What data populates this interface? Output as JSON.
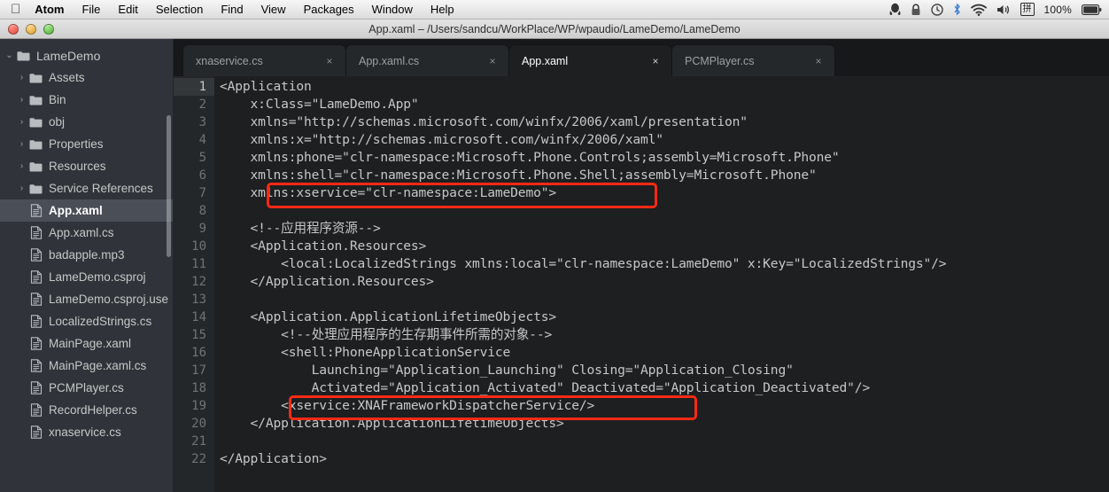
{
  "menubar": {
    "apple_icon": "apple-logo-icon",
    "items": [
      "Atom",
      "File",
      "Edit",
      "Selection",
      "Find",
      "View",
      "Packages",
      "Window",
      "Help"
    ],
    "status_icons": [
      "qq-penguin-icon",
      "lock-icon",
      "time-machine-icon",
      "bluetooth-icon",
      "wifi-icon",
      "volume-icon"
    ],
    "input_method_label": "拼",
    "battery_percent": "100%",
    "battery_icon": "battery-icon"
  },
  "window": {
    "title": "App.xaml – /Users/sandcu/WorkPlace/WP/wpaudio/LameDemo/LameDemo",
    "close_label": "close-window-button",
    "minimize_label": "minimize-window-button",
    "zoom_label": "zoom-window-button"
  },
  "sidebar": {
    "root": {
      "label": "LameDemo",
      "icon": "folder-icon",
      "disclosure": "⌄",
      "expanded": true
    },
    "items": [
      {
        "label": "Assets",
        "type": "folder",
        "icon": "folder-icon",
        "disclosure": "›",
        "selected": false
      },
      {
        "label": "Bin",
        "type": "folder",
        "icon": "folder-icon",
        "disclosure": "›",
        "selected": false
      },
      {
        "label": "obj",
        "type": "folder",
        "icon": "folder-icon",
        "disclosure": "›",
        "selected": false
      },
      {
        "label": "Properties",
        "type": "folder",
        "icon": "folder-icon",
        "disclosure": "›",
        "selected": false
      },
      {
        "label": "Resources",
        "type": "folder",
        "icon": "folder-icon",
        "disclosure": "›",
        "selected": false
      },
      {
        "label": "Service References",
        "type": "folder",
        "icon": "folder-icon",
        "disclosure": "›",
        "selected": false
      },
      {
        "label": "App.xaml",
        "type": "file",
        "icon": "file-icon",
        "selected": true
      },
      {
        "label": "App.xaml.cs",
        "type": "file",
        "icon": "file-icon",
        "selected": false
      },
      {
        "label": "badapple.mp3",
        "type": "file",
        "icon": "file-icon",
        "selected": false
      },
      {
        "label": "LameDemo.csproj",
        "type": "file",
        "icon": "file-icon",
        "selected": false
      },
      {
        "label": "LameDemo.csproj.use",
        "type": "file",
        "icon": "file-icon",
        "selected": false
      },
      {
        "label": "LocalizedStrings.cs",
        "type": "file",
        "icon": "file-icon",
        "selected": false
      },
      {
        "label": "MainPage.xaml",
        "type": "file",
        "icon": "file-icon",
        "selected": false
      },
      {
        "label": "MainPage.xaml.cs",
        "type": "file",
        "icon": "file-icon",
        "selected": false
      },
      {
        "label": "PCMPlayer.cs",
        "type": "file",
        "icon": "file-icon",
        "selected": false
      },
      {
        "label": "RecordHelper.cs",
        "type": "file",
        "icon": "file-icon",
        "selected": false
      },
      {
        "label": "xnaservice.cs",
        "type": "file",
        "icon": "file-icon",
        "selected": false
      }
    ]
  },
  "tabs": [
    {
      "label": "xnaservice.cs",
      "close": "×",
      "active": false
    },
    {
      "label": "App.xaml.cs",
      "close": "×",
      "active": false
    },
    {
      "label": "App.xaml",
      "close": "×",
      "active": true
    },
    {
      "label": "PCMPlayer.cs",
      "close": "×",
      "active": false
    }
  ],
  "editor": {
    "current_line": 1,
    "line_numbers": [
      "1",
      "2",
      "3",
      "4",
      "5",
      "6",
      "7",
      "8",
      "9",
      "10",
      "11",
      "12",
      "13",
      "14",
      "15",
      "16",
      "17",
      "18",
      "19",
      "20",
      "21",
      "22"
    ],
    "lines": [
      "<Application",
      "    x:Class=\"LameDemo.App\"",
      "    xmlns=\"http://schemas.microsoft.com/winfx/2006/xaml/presentation\"",
      "    xmlns:x=\"http://schemas.microsoft.com/winfx/2006/xaml\"",
      "    xmlns:phone=\"clr-namespace:Microsoft.Phone.Controls;assembly=Microsoft.Phone\"",
      "    xmlns:shell=\"clr-namespace:Microsoft.Phone.Shell;assembly=Microsoft.Phone\"",
      "    xmlns:xservice=\"clr-namespace:LameDemo\">",
      "",
      "    <!--应用程序资源-->",
      "    <Application.Resources>",
      "        <local:LocalizedStrings xmlns:local=\"clr-namespace:LameDemo\" x:Key=\"LocalizedStrings\"/>",
      "    </Application.Resources>",
      "",
      "    <Application.ApplicationLifetimeObjects>",
      "        <!--处理应用程序的生存期事件所需的对象-->",
      "        <shell:PhoneApplicationService",
      "            Launching=\"Application_Launching\" Closing=\"Application_Closing\"",
      "            Activated=\"Application_Activated\" Deactivated=\"Application_Deactivated\"/>",
      "        <xservice:XNAFrameworkDispatcherService/>",
      "    </Application.ApplicationLifetimeObjects>",
      "",
      "</Application>"
    ]
  },
  "annotations": [
    {
      "name": "highlight-xmlns-xservice",
      "color": "#ff2a14",
      "target_line": 7
    },
    {
      "name": "highlight-xnaframework-service",
      "color": "#ff2a14",
      "target_line": 19
    }
  ],
  "colors": {
    "editor_bg": "#1d1f21",
    "gutter_bg": "#242729",
    "sidebar_bg": "#30343a",
    "tabbar_bg": "#16181a",
    "code_fg": "#c5c8c6",
    "annotation_red": "#ff2a14"
  }
}
